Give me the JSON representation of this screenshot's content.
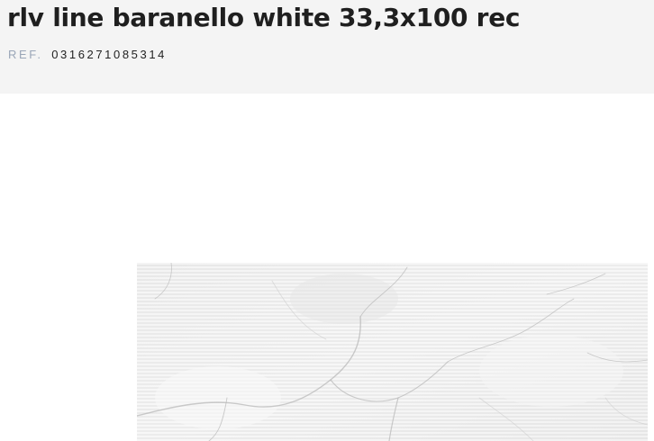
{
  "product": {
    "title": "rlv line baranello white 33,3x100 rec",
    "ref_label": "REF.",
    "ref_value": "0316271085314"
  },
  "colors": {
    "header_background": "#f4f4f4",
    "title": "#1f1f1f",
    "ref_label": "#9aa6b8",
    "tile_base": "#efefef"
  }
}
